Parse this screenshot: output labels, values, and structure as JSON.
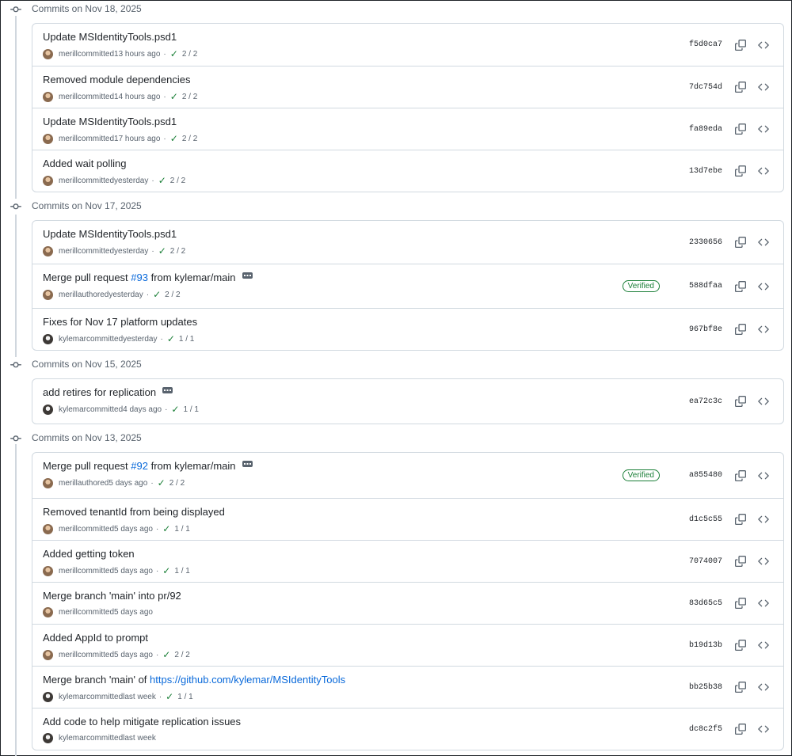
{
  "groups": [
    {
      "title": "Commits on Nov 18, 2025",
      "commits": [
        {
          "title": [
            {
              "text": "Update MSIdentityTools.psd1"
            }
          ],
          "avatar": "merill",
          "author": "merill",
          "action": "committed",
          "time": "13 hours ago",
          "checks": "2 / 2",
          "verified": false,
          "ellipsis": false,
          "sha": "f5d0ca7"
        },
        {
          "title": [
            {
              "text": "Removed module dependencies"
            }
          ],
          "avatar": "merill",
          "author": "merill",
          "action": "committed",
          "time": "14 hours ago",
          "checks": "2 / 2",
          "verified": false,
          "ellipsis": false,
          "sha": "7dc754d"
        },
        {
          "title": [
            {
              "text": "Update MSIdentityTools.psd1"
            }
          ],
          "avatar": "merill",
          "author": "merill",
          "action": "committed",
          "time": "17 hours ago",
          "checks": "2 / 2",
          "verified": false,
          "ellipsis": false,
          "sha": "fa89eda"
        },
        {
          "title": [
            {
              "text": "Added wait polling"
            }
          ],
          "avatar": "merill",
          "author": "merill",
          "action": "committed",
          "time": "yesterday",
          "checks": "2 / 2",
          "verified": false,
          "ellipsis": false,
          "sha": "13d7ebe"
        }
      ]
    },
    {
      "title": "Commits on Nov 17, 2025",
      "commits": [
        {
          "title": [
            {
              "text": "Update MSIdentityTools.psd1"
            }
          ],
          "avatar": "merill",
          "author": "merill",
          "action": "committed",
          "time": "yesterday",
          "checks": "2 / 2",
          "verified": false,
          "ellipsis": false,
          "sha": "2330656"
        },
        {
          "title": [
            {
              "text": "Merge pull request "
            },
            {
              "text": "#93",
              "link": true
            },
            {
              "text": " from kylemar/main"
            }
          ],
          "avatar": "merill",
          "author": "merill",
          "action": "authored",
          "time": "yesterday",
          "checks": "2 / 2",
          "verified": true,
          "ellipsis": true,
          "sha": "588dfaa"
        },
        {
          "title": [
            {
              "text": "Fixes for Nov 17 platform updates"
            }
          ],
          "avatar": "kylemar",
          "author": "kylemar",
          "action": "committed",
          "time": "yesterday",
          "checks": "1 / 1",
          "verified": false,
          "ellipsis": false,
          "sha": "967bf8e"
        }
      ]
    },
    {
      "title": "Commits on Nov 15, 2025",
      "commits": [
        {
          "title": [
            {
              "text": "add retires for replication"
            }
          ],
          "avatar": "kylemar",
          "author": "kylemar",
          "action": "committed",
          "time": "4 days ago",
          "checks": "1 / 1",
          "verified": false,
          "ellipsis": true,
          "sha": "ea72c3c"
        }
      ]
    },
    {
      "title": "Commits on Nov 13, 2025",
      "commits": [
        {
          "title": [
            {
              "text": "Merge pull request "
            },
            {
              "text": "#92",
              "link": true
            },
            {
              "text": " from kylemar/main"
            }
          ],
          "avatar": "merill",
          "author": "merill",
          "action": "authored",
          "time": "5 days ago",
          "checks": "2 / 2",
          "verified": true,
          "ellipsis": true,
          "sha": "a855480"
        },
        {
          "title": [
            {
              "text": "Removed tenantId from being displayed"
            }
          ],
          "avatar": "merill",
          "author": "merill",
          "action": "committed",
          "time": "5 days ago",
          "checks": "1 / 1",
          "verified": false,
          "ellipsis": false,
          "sha": "d1c5c55"
        },
        {
          "title": [
            {
              "text": "Added getting token"
            }
          ],
          "avatar": "merill",
          "author": "merill",
          "action": "committed",
          "time": "5 days ago",
          "checks": "1 / 1",
          "verified": false,
          "ellipsis": false,
          "sha": "7074007"
        },
        {
          "title": [
            {
              "text": "Merge branch 'main' into pr/92"
            }
          ],
          "avatar": "merill",
          "author": "merill",
          "action": "committed",
          "time": "5 days ago",
          "checks": "",
          "verified": false,
          "ellipsis": false,
          "sha": "83d65c5"
        },
        {
          "title": [
            {
              "text": "Added AppId to prompt"
            }
          ],
          "avatar": "merill",
          "author": "merill",
          "action": "committed",
          "time": "5 days ago",
          "checks": "2 / 2",
          "verified": false,
          "ellipsis": false,
          "sha": "b19d13b"
        },
        {
          "title": [
            {
              "text": "Merge branch 'main' of "
            },
            {
              "text": "https://github.com/kylemar/MSIdentityTools",
              "link": true
            }
          ],
          "avatar": "kylemar",
          "author": "kylemar",
          "action": "committed",
          "time": "last week",
          "checks": "1 / 1",
          "verified": false,
          "ellipsis": false,
          "sha": "bb25b38"
        },
        {
          "title": [
            {
              "text": "Add code to help mitigate replication issues"
            }
          ],
          "avatar": "kylemar",
          "author": "kylemar",
          "action": "committed",
          "time": "last week",
          "checks": "",
          "verified": false,
          "ellipsis": false,
          "sha": "dc8c2f5"
        }
      ]
    }
  ],
  "labels": {
    "verified": "Verified",
    "check_icon": "check-icon",
    "copy_icon": "copy-icon",
    "browse_icon": "code-icon",
    "commit_icon": "git-commit-icon"
  },
  "colors": {
    "link": "#0969da",
    "success": "#1a7f37",
    "muted": "#59636e",
    "border": "#d1d9e0"
  }
}
